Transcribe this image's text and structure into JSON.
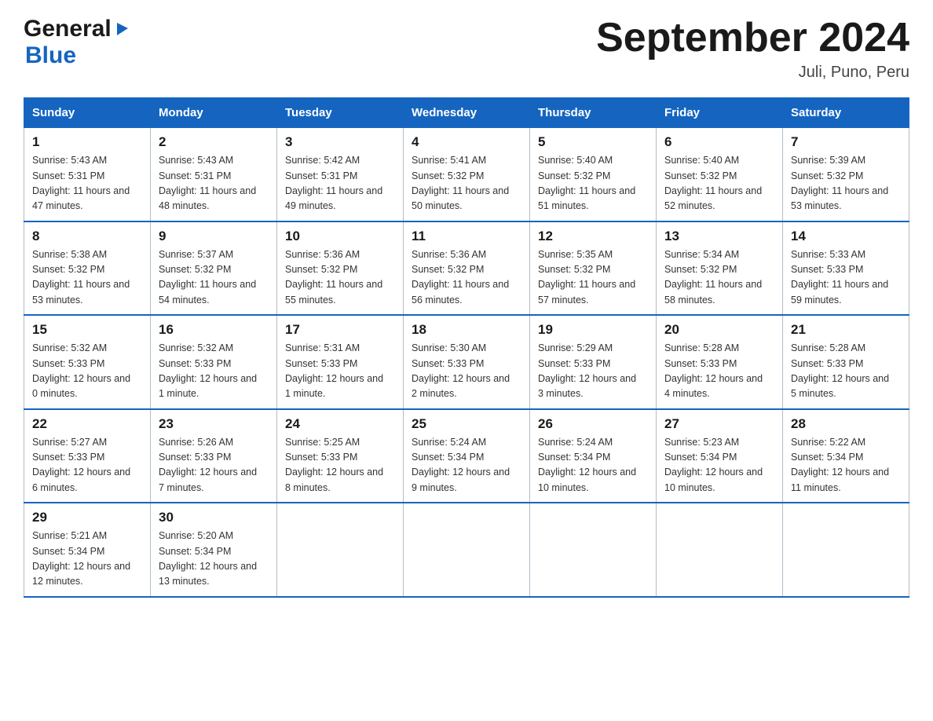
{
  "logo": {
    "general": "General",
    "triangle": "▶",
    "blue": "Blue"
  },
  "title": "September 2024",
  "location": "Juli, Puno, Peru",
  "weekdays": [
    "Sunday",
    "Monday",
    "Tuesday",
    "Wednesday",
    "Thursday",
    "Friday",
    "Saturday"
  ],
  "weeks": [
    [
      {
        "day": "1",
        "sunrise": "5:43 AM",
        "sunset": "5:31 PM",
        "daylight": "11 hours and 47 minutes."
      },
      {
        "day": "2",
        "sunrise": "5:43 AM",
        "sunset": "5:31 PM",
        "daylight": "11 hours and 48 minutes."
      },
      {
        "day": "3",
        "sunrise": "5:42 AM",
        "sunset": "5:31 PM",
        "daylight": "11 hours and 49 minutes."
      },
      {
        "day": "4",
        "sunrise": "5:41 AM",
        "sunset": "5:32 PM",
        "daylight": "11 hours and 50 minutes."
      },
      {
        "day": "5",
        "sunrise": "5:40 AM",
        "sunset": "5:32 PM",
        "daylight": "11 hours and 51 minutes."
      },
      {
        "day": "6",
        "sunrise": "5:40 AM",
        "sunset": "5:32 PM",
        "daylight": "11 hours and 52 minutes."
      },
      {
        "day": "7",
        "sunrise": "5:39 AM",
        "sunset": "5:32 PM",
        "daylight": "11 hours and 53 minutes."
      }
    ],
    [
      {
        "day": "8",
        "sunrise": "5:38 AM",
        "sunset": "5:32 PM",
        "daylight": "11 hours and 53 minutes."
      },
      {
        "day": "9",
        "sunrise": "5:37 AM",
        "sunset": "5:32 PM",
        "daylight": "11 hours and 54 minutes."
      },
      {
        "day": "10",
        "sunrise": "5:36 AM",
        "sunset": "5:32 PM",
        "daylight": "11 hours and 55 minutes."
      },
      {
        "day": "11",
        "sunrise": "5:36 AM",
        "sunset": "5:32 PM",
        "daylight": "11 hours and 56 minutes."
      },
      {
        "day": "12",
        "sunrise": "5:35 AM",
        "sunset": "5:32 PM",
        "daylight": "11 hours and 57 minutes."
      },
      {
        "day": "13",
        "sunrise": "5:34 AM",
        "sunset": "5:32 PM",
        "daylight": "11 hours and 58 minutes."
      },
      {
        "day": "14",
        "sunrise": "5:33 AM",
        "sunset": "5:33 PM",
        "daylight": "11 hours and 59 minutes."
      }
    ],
    [
      {
        "day": "15",
        "sunrise": "5:32 AM",
        "sunset": "5:33 PM",
        "daylight": "12 hours and 0 minutes."
      },
      {
        "day": "16",
        "sunrise": "5:32 AM",
        "sunset": "5:33 PM",
        "daylight": "12 hours and 1 minute."
      },
      {
        "day": "17",
        "sunrise": "5:31 AM",
        "sunset": "5:33 PM",
        "daylight": "12 hours and 1 minute."
      },
      {
        "day": "18",
        "sunrise": "5:30 AM",
        "sunset": "5:33 PM",
        "daylight": "12 hours and 2 minutes."
      },
      {
        "day": "19",
        "sunrise": "5:29 AM",
        "sunset": "5:33 PM",
        "daylight": "12 hours and 3 minutes."
      },
      {
        "day": "20",
        "sunrise": "5:28 AM",
        "sunset": "5:33 PM",
        "daylight": "12 hours and 4 minutes."
      },
      {
        "day": "21",
        "sunrise": "5:28 AM",
        "sunset": "5:33 PM",
        "daylight": "12 hours and 5 minutes."
      }
    ],
    [
      {
        "day": "22",
        "sunrise": "5:27 AM",
        "sunset": "5:33 PM",
        "daylight": "12 hours and 6 minutes."
      },
      {
        "day": "23",
        "sunrise": "5:26 AM",
        "sunset": "5:33 PM",
        "daylight": "12 hours and 7 minutes."
      },
      {
        "day": "24",
        "sunrise": "5:25 AM",
        "sunset": "5:33 PM",
        "daylight": "12 hours and 8 minutes."
      },
      {
        "day": "25",
        "sunrise": "5:24 AM",
        "sunset": "5:34 PM",
        "daylight": "12 hours and 9 minutes."
      },
      {
        "day": "26",
        "sunrise": "5:24 AM",
        "sunset": "5:34 PM",
        "daylight": "12 hours and 10 minutes."
      },
      {
        "day": "27",
        "sunrise": "5:23 AM",
        "sunset": "5:34 PM",
        "daylight": "12 hours and 10 minutes."
      },
      {
        "day": "28",
        "sunrise": "5:22 AM",
        "sunset": "5:34 PM",
        "daylight": "12 hours and 11 minutes."
      }
    ],
    [
      {
        "day": "29",
        "sunrise": "5:21 AM",
        "sunset": "5:34 PM",
        "daylight": "12 hours and 12 minutes."
      },
      {
        "day": "30",
        "sunrise": "5:20 AM",
        "sunset": "5:34 PM",
        "daylight": "12 hours and 13 minutes."
      },
      null,
      null,
      null,
      null,
      null
    ]
  ],
  "labels": {
    "sunrise": "Sunrise:",
    "sunset": "Sunset:",
    "daylight": "Daylight:"
  }
}
